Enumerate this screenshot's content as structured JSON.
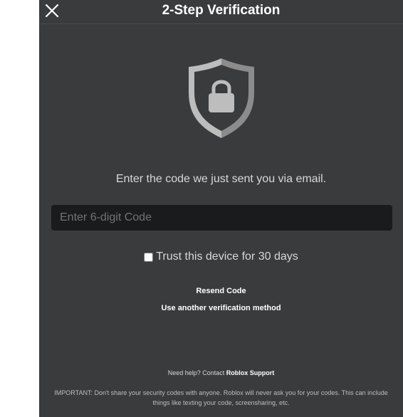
{
  "header": {
    "title": "2-Step Verification",
    "close_icon": "close-icon"
  },
  "shield_icon": "shield-lock-icon",
  "instruction": "Enter the code we just sent you via email.",
  "code_input": {
    "value": "",
    "placeholder": "Enter 6-digit Code"
  },
  "trust_device": {
    "label": "Trust this device for 30 days",
    "checked": false
  },
  "resend_label": "Resend Code",
  "another_method_label": "Use another verification method",
  "help": {
    "prefix": "Need help? Contact",
    "link": "Roblox Support"
  },
  "important_note": "IMPORTANT: Don't share your security codes with anyone. Roblox will never ask you for your codes. This can include things like texting your code, screensharing, etc.",
  "colors": {
    "modal_bg": "#393b3d",
    "input_bg": "#191b1d",
    "shield_light": "#bdbdbd",
    "shield_dark": "#8c8c8c"
  }
}
